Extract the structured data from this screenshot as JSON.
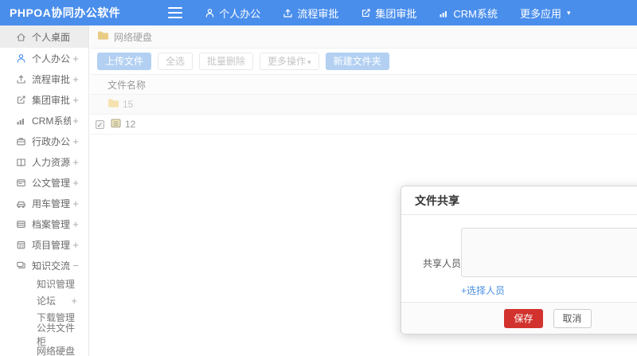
{
  "navbar": {
    "brand": "PHPOA协同办公软件",
    "items": [
      {
        "label": "个人办公",
        "icon": "user-icon"
      },
      {
        "label": "流程审批",
        "icon": "approve-icon"
      },
      {
        "label": "集团审批",
        "icon": "edit-icon"
      },
      {
        "label": "CRM系统",
        "icon": "chart-icon"
      },
      {
        "label": "更多应用",
        "icon": "caret-down-icon",
        "caret": "▾"
      }
    ]
  },
  "sidebar": {
    "items": [
      {
        "label": "个人桌面",
        "icon": "home-icon",
        "expand": ""
      },
      {
        "label": "个人办公",
        "icon": "user-icon",
        "expand": "+"
      },
      {
        "label": "流程审批",
        "icon": "approve-icon",
        "expand": "+"
      },
      {
        "label": "集团审批",
        "icon": "edit-icon",
        "expand": "+"
      },
      {
        "label": "CRM系统",
        "icon": "chart-icon",
        "expand": "+"
      },
      {
        "label": "行政办公",
        "icon": "briefcase-icon",
        "expand": "+"
      },
      {
        "label": "人力资源",
        "icon": "book-icon",
        "expand": "+"
      },
      {
        "label": "公文管理",
        "icon": "document-icon",
        "expand": "+"
      },
      {
        "label": "用车管理",
        "icon": "car-icon",
        "expand": "+"
      },
      {
        "label": "档案管理",
        "icon": "archive-icon",
        "expand": "+"
      },
      {
        "label": "项目管理",
        "icon": "project-icon",
        "expand": "+"
      },
      {
        "label": "知识交流",
        "icon": "chat-icon",
        "expand": "−"
      }
    ],
    "subitems": [
      {
        "label": "知识管理",
        "expand": ""
      },
      {
        "label": "论坛",
        "expand": "+"
      },
      {
        "label": "下载管理",
        "expand": ""
      },
      {
        "label": "公共文件柜",
        "expand": ""
      },
      {
        "label": "网络硬盘",
        "expand": ""
      }
    ]
  },
  "breadcrumb": {
    "label": "网络硬盘",
    "icon": "folder-icon"
  },
  "toolbar": {
    "buttons": [
      {
        "label": "上传文件",
        "style": "primary"
      },
      {
        "label": "全选",
        "style": "default"
      },
      {
        "label": "批量删除",
        "style": "default"
      },
      {
        "label": "更多操作",
        "style": "default",
        "caret": "▾"
      },
      {
        "label": "新建文件夹",
        "style": "primary"
      }
    ]
  },
  "file_table": {
    "name_header": "文件名称",
    "rows": [
      {
        "name": "15",
        "type": "folder",
        "faded": true
      },
      {
        "name": "12",
        "type": "file",
        "checked": true,
        "check_glyph": "✓"
      }
    ]
  },
  "modal": {
    "title": "文件共享",
    "field_label": "共享人员",
    "select_link": "+选择人员",
    "save_label": "保存",
    "cancel_label": "取消"
  },
  "colors": {
    "navbar_blue": "#4a8eec",
    "primary_button_blue": "#b3d0f2",
    "save_red": "#d2322d",
    "link_blue": "#4a90e2",
    "folder_yellow": "#f2cf71"
  }
}
